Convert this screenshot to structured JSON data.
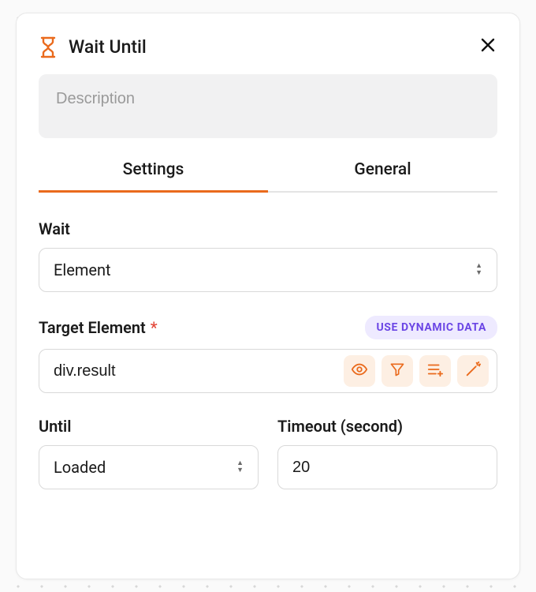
{
  "header": {
    "title": "Wait Until",
    "icon": "hourglass-icon"
  },
  "description": {
    "placeholder": "Description",
    "value": ""
  },
  "tabs": {
    "settings": "Settings",
    "general": "General",
    "active": "settings"
  },
  "fields": {
    "wait": {
      "label": "Wait",
      "value": "Element"
    },
    "target": {
      "label": "Target Element",
      "required_mark": "*",
      "badge": "USE DYNAMIC DATA",
      "value": "div.result"
    },
    "until": {
      "label": "Until",
      "value": "Loaded"
    },
    "timeout": {
      "label": "Timeout (second)",
      "value": "20"
    }
  }
}
